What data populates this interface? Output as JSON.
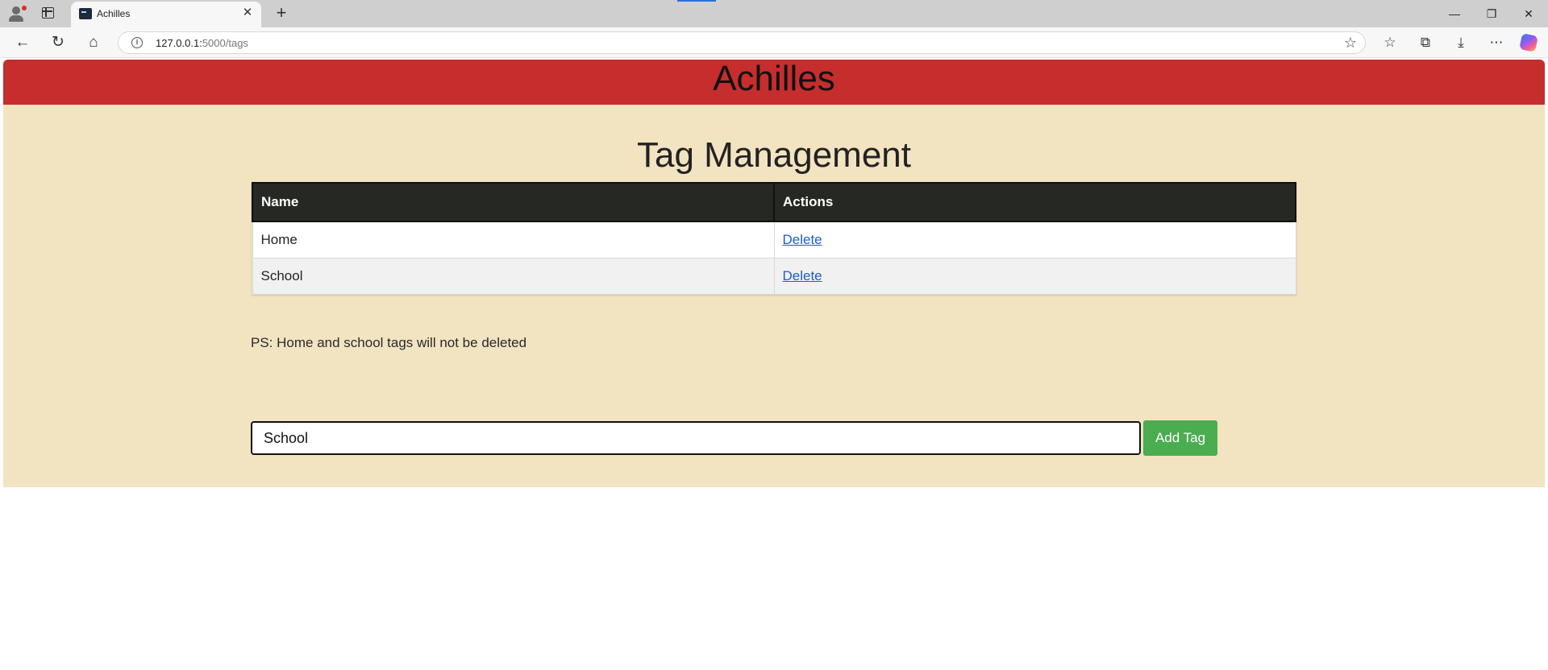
{
  "browser": {
    "tab_title": "Achilles",
    "tab_close": "✕",
    "new_tab": "+",
    "url_host": "127.0.0.1:",
    "url_path": "5000/tags",
    "window_controls": {
      "minimize": "—",
      "restore": "❐",
      "close": "✕"
    },
    "nav": {
      "back": "←",
      "reload": "↻",
      "home": "⌂"
    },
    "toolbar_icons": {
      "favorites": "☆",
      "collections": "⧉",
      "downloads": "⤓",
      "more": "⋯",
      "star": "☆"
    }
  },
  "site": {
    "title": "Achilles",
    "heading": "Tag Management",
    "table": {
      "headers": [
        "Name",
        "Actions"
      ],
      "rows": [
        {
          "name": "Home",
          "action": "Delete"
        },
        {
          "name": "School",
          "action": "Delete"
        }
      ]
    },
    "note": "PS: Home and school tags will not be deleted",
    "form": {
      "input_value": "School",
      "button_label": "Add Tag"
    }
  },
  "colors": {
    "header_red": "#c62d2d",
    "content_bg": "#f2e3c1",
    "table_header": "#262923",
    "button_green": "#4aad4f",
    "link_blue": "#1a5fd0"
  }
}
